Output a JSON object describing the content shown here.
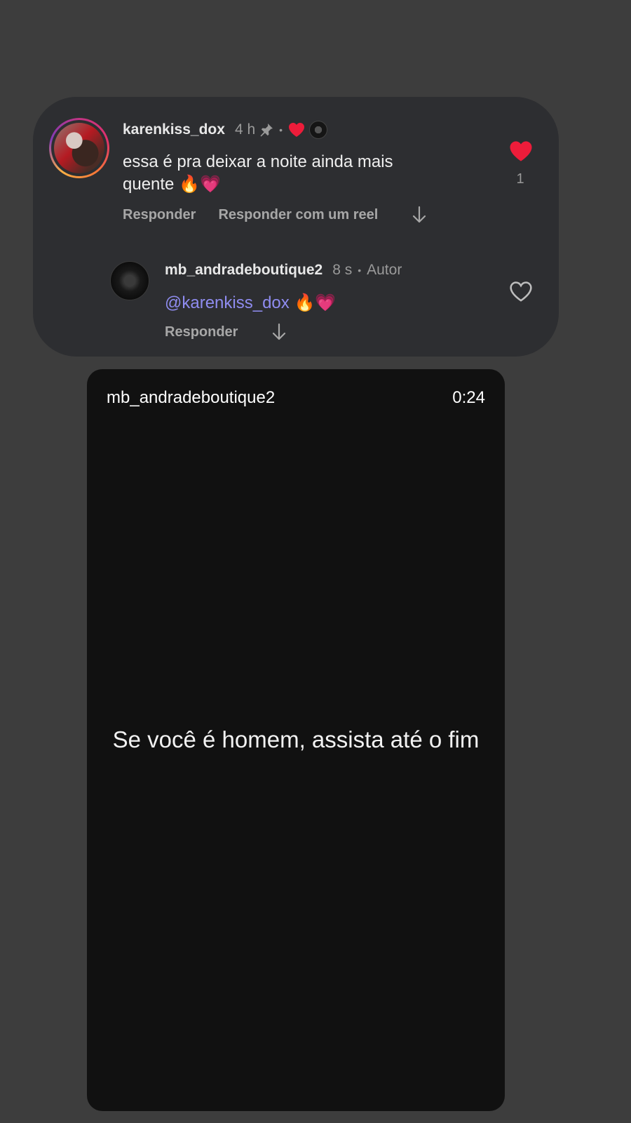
{
  "comment": {
    "username": "karenkiss_dox",
    "time": "4 h",
    "text_line1": "essa é pra deixar a noite ainda mais",
    "text_line2": "quente 🔥💗",
    "reply_label": "Responder",
    "reply_reel_label": "Responder com um reel",
    "like_count": "1",
    "liked": true,
    "icons": [
      "pin-icon",
      "heart-icon",
      "author-avatar-icon",
      "arrow-down-icon"
    ]
  },
  "reply": {
    "username": "mb_andradeboutique2",
    "time": "8 s",
    "badge": "Autor",
    "mention": "@karenkiss_dox",
    "emojis": "🔥💗",
    "reply_label": "Responder",
    "liked": false
  },
  "video": {
    "author": "mb_andradeboutique2",
    "duration": "0:24",
    "caption": "Se você é homem, assista até o fim"
  },
  "colors": {
    "background": "#3d3d3d",
    "card": "#2d2e31",
    "like_red": "#ed1c3a",
    "mention": "#8f8cf0",
    "video_bg": "#111111"
  }
}
